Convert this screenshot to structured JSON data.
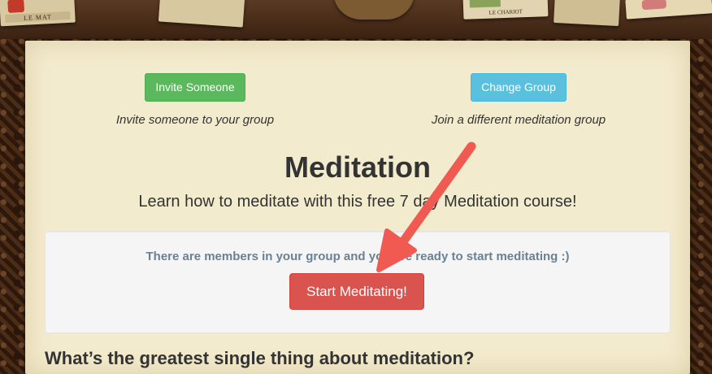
{
  "header_cards": {
    "left_card_label": "LE MAT",
    "right_card_label": "LE CHARIOT"
  },
  "actions": {
    "invite": {
      "label": "Invite Someone",
      "caption": "Invite someone to your group",
      "color": "#5cb85c"
    },
    "change": {
      "label": "Change Group",
      "caption": "Join a different meditation group",
      "color": "#5bc0de"
    }
  },
  "main": {
    "title": "Meditation",
    "subtitle": "Learn how to meditate with this free 7 day Meditation course!",
    "status_message": "There are members in your group and you are ready to start meditating :)",
    "start_button_label": "Start Meditating!",
    "start_button_color": "#d9534f",
    "question_heading": "What’s the greatest single thing about meditation?"
  },
  "annotation": {
    "arrow_color": "#f05a50"
  }
}
